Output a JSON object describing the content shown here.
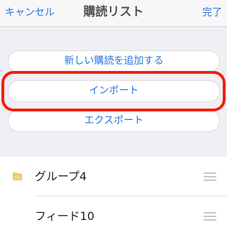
{
  "navbar": {
    "cancel_label": "キャンセル",
    "title": "購読リスト",
    "done_label": "完了"
  },
  "actions": {
    "add_label": "新しい購読を追加する",
    "import_label": "インポート",
    "export_label": "エクスポート"
  },
  "list": {
    "items": [
      {
        "label": "グループ4",
        "icon": "folder-icon"
      },
      {
        "label": "フィード10",
        "icon": ""
      }
    ]
  },
  "colors": {
    "accent": "#2a75d8",
    "highlight": "#f31e0e",
    "folder": "#f5d67a"
  }
}
